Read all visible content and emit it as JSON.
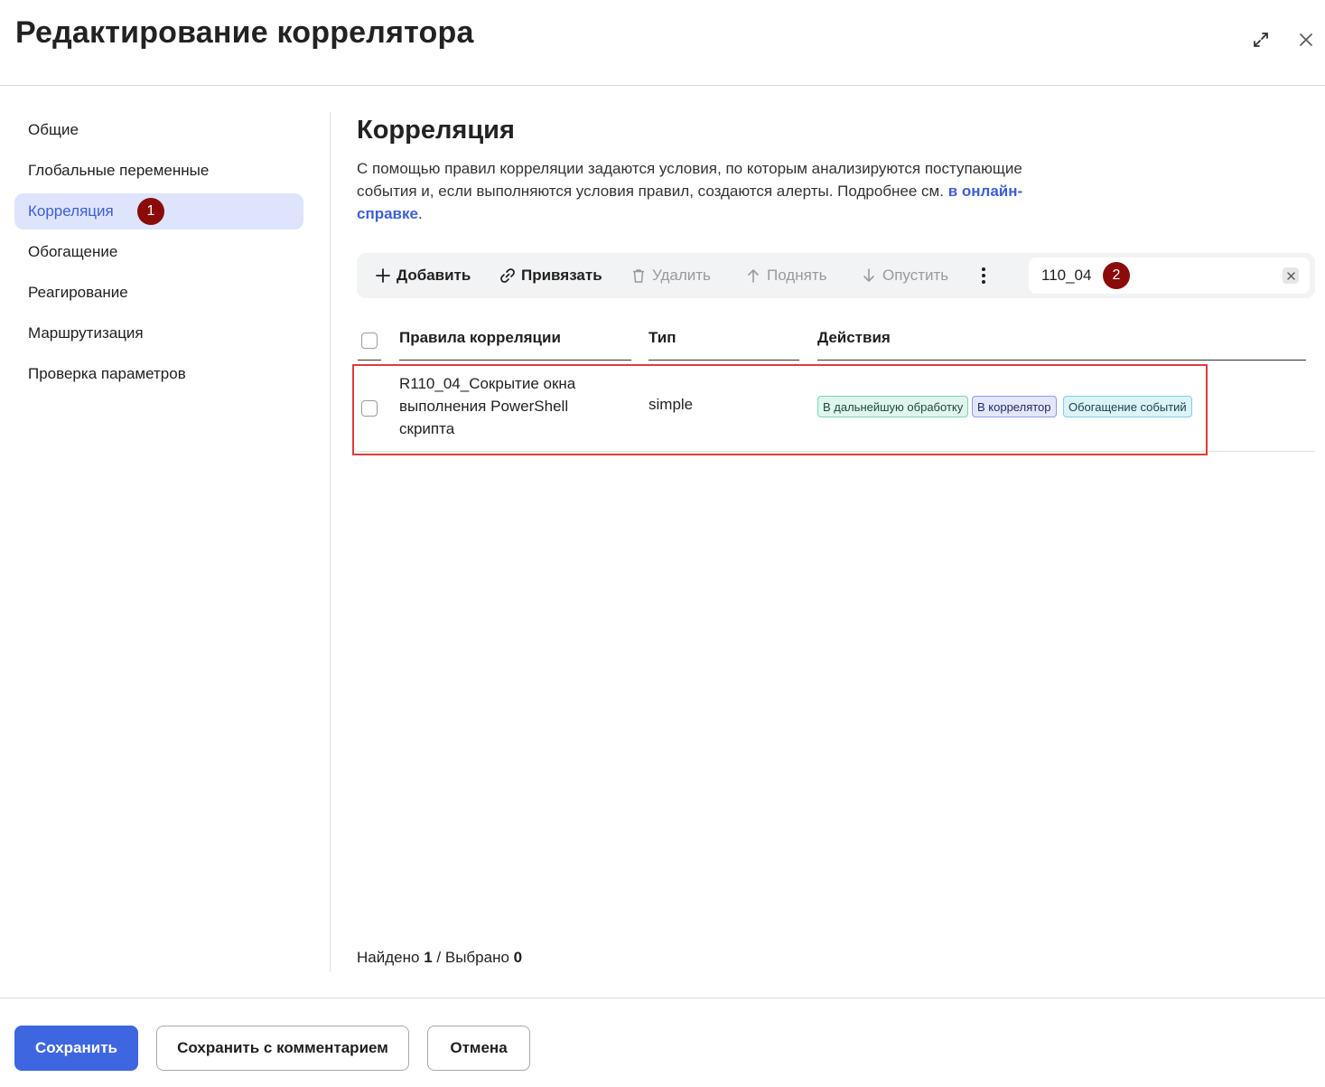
{
  "dialog": {
    "title": "Редактирование коррелятора"
  },
  "sidebar": {
    "items": [
      {
        "label": "Общие",
        "active": false
      },
      {
        "label": "Глобальные переменные",
        "active": false
      },
      {
        "label": "Корреляция",
        "active": true,
        "badge": "1"
      },
      {
        "label": "Обогащение",
        "active": false
      },
      {
        "label": "Реагирование",
        "active": false
      },
      {
        "label": "Маршрутизация",
        "active": false
      },
      {
        "label": "Проверка параметров",
        "active": false
      }
    ]
  },
  "section": {
    "title": "Корреляция",
    "description": "С помощью правил корреляции задаются условия, по которым анализируются поступающие события и, если выполняются условия правил, создаются алерты. Подробнее см.",
    "link_text": "в онлайн-справке",
    "description_end": "."
  },
  "toolbar": {
    "add": "Добавить",
    "link": "Привязать",
    "delete": "Удалить",
    "up": "Поднять",
    "down": "Опустить",
    "search_value": "110_04",
    "search_badge": "2"
  },
  "table": {
    "columns": [
      "Правила корреляции",
      "Тип",
      "Действия"
    ],
    "rows": [
      {
        "name": "R110_04_Сокрытие окна выполнения PowerShell скрипта",
        "type": "simple",
        "actions": [
          "В дальнейшую обработку",
          "В коррелятор",
          "Обогащение событий"
        ]
      }
    ]
  },
  "counts": {
    "found_label": "Найдено",
    "found": "1",
    "separator": "/",
    "selected_label": "Выбрано",
    "selected": "0"
  },
  "footer": {
    "save": "Сохранить",
    "save_comment": "Сохранить с комментарием",
    "cancel": "Отмена"
  },
  "colors": {
    "accent": "#3d66e0",
    "active_nav_bg": "#dde4fb",
    "badge": "#8b0a0a",
    "highlight": "#e03c3c"
  }
}
